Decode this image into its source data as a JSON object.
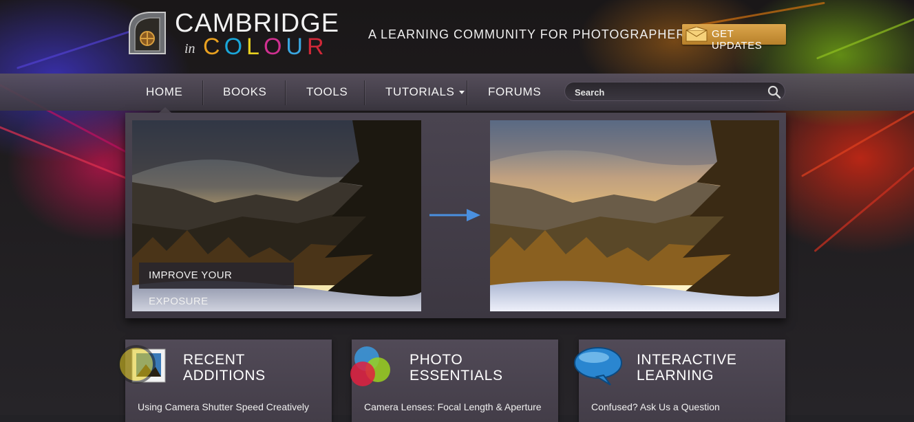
{
  "brand": {
    "title": "CAMBRIDGE",
    "in": "in",
    "colour_letters": [
      "C",
      "O",
      "L",
      "O",
      "U",
      "R"
    ],
    "colour_colors": [
      "#e8a020",
      "#1aa6d8",
      "#e8d020",
      "#d03090",
      "#3aa6e0",
      "#d02838"
    ]
  },
  "tagline": "A LEARNING COMMUNITY FOR PHOTOGRAPHERS",
  "get_updates": {
    "label": "GET UPDATES",
    "icon": "envelope-icon"
  },
  "nav": {
    "home": "HOME",
    "books": "BOOKS",
    "tools": "TOOLS",
    "tutorials": "TUTORIALS",
    "forums": "FORUMS"
  },
  "search": {
    "placeholder": "Search",
    "icon": "magnifier-icon"
  },
  "slider": {
    "caption": "IMPROVE YOUR EXPOSURE"
  },
  "cards": [
    {
      "title_line1": "RECENT",
      "title_line2": "ADDITIONS",
      "link": "Using Camera Shutter Speed Creatively",
      "icon": "photo-magnifier-icon"
    },
    {
      "title_line1": "PHOTO",
      "title_line2": "ESSENTIALS",
      "link": "Camera Lenses: Focal Length & Aperture",
      "icon": "color-circles-icon"
    },
    {
      "title_line1": "INTERACTIVE",
      "title_line2": "LEARNING",
      "link": "Confused? Ask Us a Question",
      "icon": "speech-bubble-icon"
    }
  ],
  "colors": {
    "accent_orange": "#c9903a",
    "nav_bg": "#4a4450",
    "panel_bg": "#433d48"
  }
}
